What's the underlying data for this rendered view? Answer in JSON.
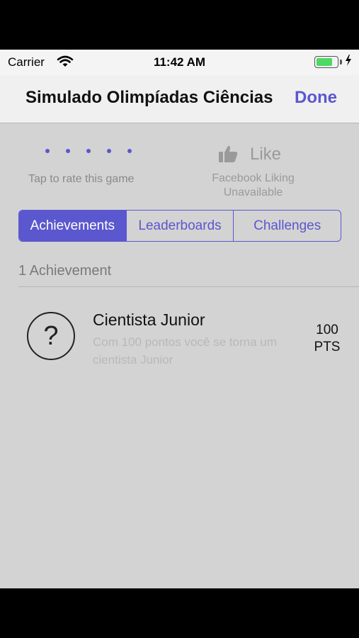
{
  "status_bar": {
    "carrier": "Carrier",
    "time": "11:42 AM"
  },
  "nav": {
    "title": "Simulado Olimpíadas Ciências",
    "done_label": "Done"
  },
  "rating": {
    "prompt": "Tap to rate this game",
    "dot_count": 5
  },
  "like": {
    "label": "Like",
    "status_line1": "Facebook Liking",
    "status_line2": "Unavailable"
  },
  "tabs": [
    {
      "label": "Achievements",
      "active": true
    },
    {
      "label": "Leaderboards",
      "active": false
    },
    {
      "label": "Challenges",
      "active": false
    }
  ],
  "section": {
    "header": "1 Achievement"
  },
  "achievements": [
    {
      "icon_symbol": "?",
      "title": "Cientista Junior",
      "description": "Com 100 pontos você se torna um cientista Junior",
      "points_value": "100",
      "points_unit": "PTS"
    }
  ],
  "colors": {
    "accent": "#5b57cf",
    "background": "#d3d3d3",
    "battery": "#4cd964"
  },
  "icons": {
    "wifi": "wifi-icon",
    "battery": "battery-icon",
    "charging": "charging-bolt-icon",
    "like": "thumbs-up-icon",
    "achievement": "question-mark-circle-icon"
  }
}
